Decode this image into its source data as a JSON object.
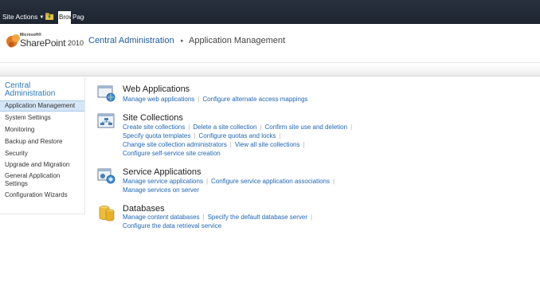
{
  "ribbon": {
    "site_actions": "Site Actions",
    "tabs": [
      {
        "label": "Browse"
      },
      {
        "label": "Page"
      }
    ]
  },
  "brand": {
    "microsoft": "Microsoft®",
    "product": "SharePoint",
    "year": "2010"
  },
  "breadcrumb": {
    "root": "Central Administration",
    "separator": "▸",
    "current": "Application Management"
  },
  "leftnav": {
    "heading": "Central Administration",
    "items": [
      {
        "label": "Application Management"
      },
      {
        "label": "System Settings"
      },
      {
        "label": "Monitoring"
      },
      {
        "label": "Backup and Restore"
      },
      {
        "label": "Security"
      },
      {
        "label": "Upgrade and Migration"
      },
      {
        "label": "General Application Settings"
      },
      {
        "label": "Configuration Wizards"
      }
    ]
  },
  "sections": {
    "web_apps": {
      "title": "Web Applications",
      "icon": "web-applications-icon",
      "lines": [
        [
          "Manage web applications",
          "Configure alternate access mappings"
        ]
      ]
    },
    "site_collections": {
      "title": "Site Collections",
      "icon": "site-collections-icon",
      "lines": [
        [
          "Create site collections",
          "Delete a site collection",
          "Confirm site use and deletion"
        ],
        [
          "Specify quota templates",
          "Configure quotas and locks"
        ],
        [
          "Change site collection administrators",
          "View all site collections"
        ],
        [
          "Configure self-service site creation"
        ]
      ]
    },
    "service_apps": {
      "title": "Service Applications",
      "icon": "service-applications-icon",
      "lines": [
        [
          "Manage service applications",
          "Configure service application associations"
        ],
        [
          "Manage services on server"
        ]
      ]
    },
    "databases": {
      "title": "Databases",
      "icon": "databases-icon",
      "lines": [
        [
          "Manage content databases",
          "Specify the default database server"
        ],
        [
          "Configure the data retrieval service"
        ]
      ]
    }
  },
  "colors": {
    "ribbon_bg": "#1e2631",
    "link": "#1f66b5",
    "nav_heading": "#2f7ab7",
    "nav_selected_bg": "#d4e6f7"
  }
}
